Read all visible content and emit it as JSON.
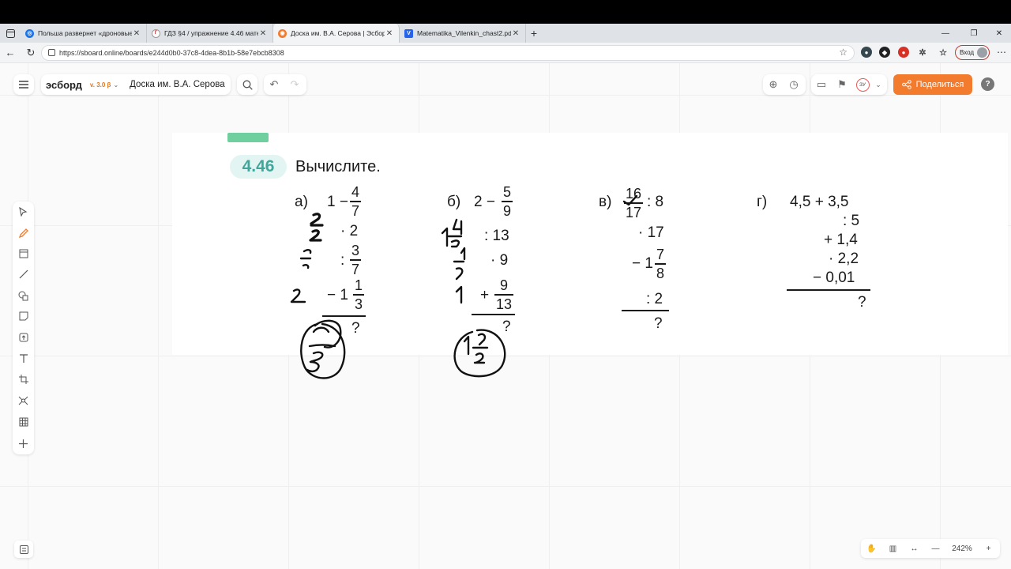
{
  "browser": {
    "tabs": [
      {
        "title": "Польша развернет «дроновые",
        "color": "#1a73e8"
      },
      {
        "title": "ГДЗ §4 / упражнение 4.46 матем",
        "color": "#e94235"
      },
      {
        "title": "Доска им. В.А. Серова | Эсборд",
        "color": "#f37b2e",
        "active": true
      },
      {
        "title": "Matematika_Vilenkin_chast2.pdf",
        "color": "#2563eb"
      }
    ],
    "url": "https://sboard.online/boards/e244d0b0-37c8-4dea-8b1b-58e7ebcb8308",
    "login_label": "Вход"
  },
  "app": {
    "logo": "эсборд",
    "version": "v. 3.0 β",
    "board_name": "Доска им. В.А. Серова",
    "share_label": "Поделиться",
    "help_label": "?",
    "user_badge": "ЗУ",
    "zoom": "242%"
  },
  "exercise": {
    "number": "4.46",
    "title": "Вычислите.",
    "a": {
      "label": "а)",
      "start": "1 −",
      "f1": [
        "4",
        "7"
      ],
      "op2": "· 2",
      "op3": ":",
      "f3": [
        "3",
        "7"
      ],
      "op4": "− 1",
      "f4": [
        "1",
        "3"
      ],
      "q": "?"
    },
    "b": {
      "label": "б)",
      "start": "2 −",
      "f1": [
        "5",
        "9"
      ],
      "op2": ": 13",
      "op3": "· 9",
      "op4": "+",
      "f4": [
        "9",
        "13"
      ],
      "q": "?"
    },
    "v": {
      "label": "в)",
      "f1": [
        "16",
        "17"
      ],
      "op1": ": 8",
      "op2": "· 17",
      "op3": "− 1",
      "f3": [
        "7",
        "8"
      ],
      "op4": ": 2",
      "q": "?"
    },
    "g": {
      "label": "г)",
      "line1": "4,5  + 3,5",
      "line2": ": 5",
      "line3": "+ 1,4",
      "line4": "· 2,2",
      "line5": "− 0,01",
      "q": "?"
    }
  }
}
